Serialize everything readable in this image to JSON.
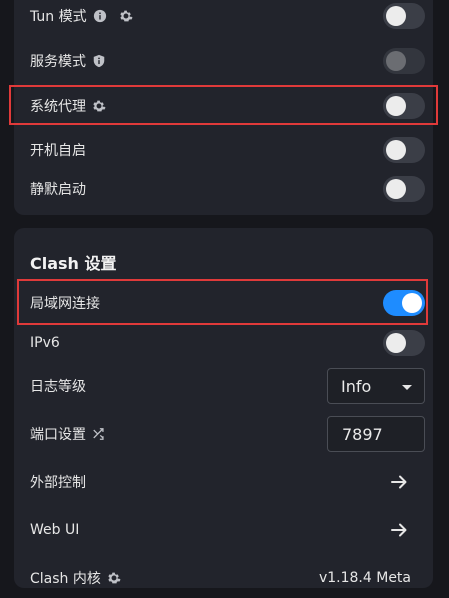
{
  "system": {
    "items": [
      {
        "label": "Tun 模式",
        "icons": [
          "info-icon",
          "gear-icon"
        ],
        "enabled": false
      },
      {
        "label": "服务模式",
        "icons": [
          "shield-icon"
        ],
        "enabled": false,
        "disabled": true
      },
      {
        "label": "系统代理",
        "icons": [
          "gear-icon"
        ],
        "enabled": false
      },
      {
        "label": "开机自启",
        "icons": [],
        "enabled": false
      },
      {
        "label": "静默启动",
        "icons": [],
        "enabled": false
      }
    ]
  },
  "clash": {
    "title": "Clash 设置",
    "lan": {
      "label": "局域网连接",
      "enabled": true
    },
    "ipv6": {
      "label": "IPv6",
      "enabled": false
    },
    "log_level": {
      "label": "日志等级",
      "value": "Info"
    },
    "port": {
      "label": "端口设置",
      "value": "7897"
    },
    "external": {
      "label": "外部控制"
    },
    "webui": {
      "label": "Web UI"
    },
    "core": {
      "label": "Clash 内核",
      "value": "v1.18.4 Meta"
    }
  },
  "colors": {
    "accent": "#1e8cff",
    "highlight": "#e03a3a",
    "background": "#16171c",
    "card": "#22242c"
  }
}
